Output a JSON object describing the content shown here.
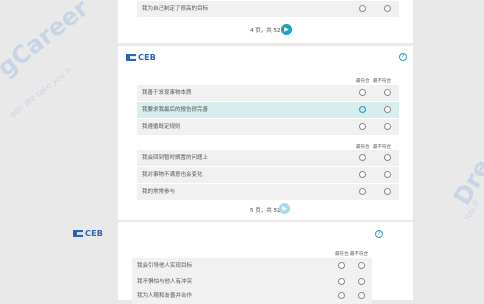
{
  "watermark": {
    "left_text": "gCareer",
    "left_sub": "ger. We take you h",
    "right_text": "Dre",
    "right_sub": "You d"
  },
  "panel1": {
    "row_text": "我为自己制定了很高的目标",
    "page": "4 页，共 52",
    "next_icon": "arrow-right"
  },
  "panel2": {
    "logo": "CEB",
    "help_icon": "?",
    "col_most": "最符合",
    "col_least": "最不符合",
    "group1": [
      "我善于发现事物本质",
      "我要求我最后的报告很完善",
      "我遵循既定规则"
    ],
    "group2": [
      "我会回到暂时搁置的问题上",
      "我对事物不满意也会变化",
      "我的常常参与"
    ],
    "page": "5 页，共 52",
    "next_icon": "arrow-right"
  },
  "panel3": {
    "logo": "CEB",
    "help_icon": "?",
    "col_most": "最符合",
    "col_least": "最不符合",
    "rows": [
      "我会引导他人实现目标",
      "我不惧怕与他人有冲突",
      "我为人随和友善并合作"
    ]
  },
  "accent_color": "#1aa0c0"
}
